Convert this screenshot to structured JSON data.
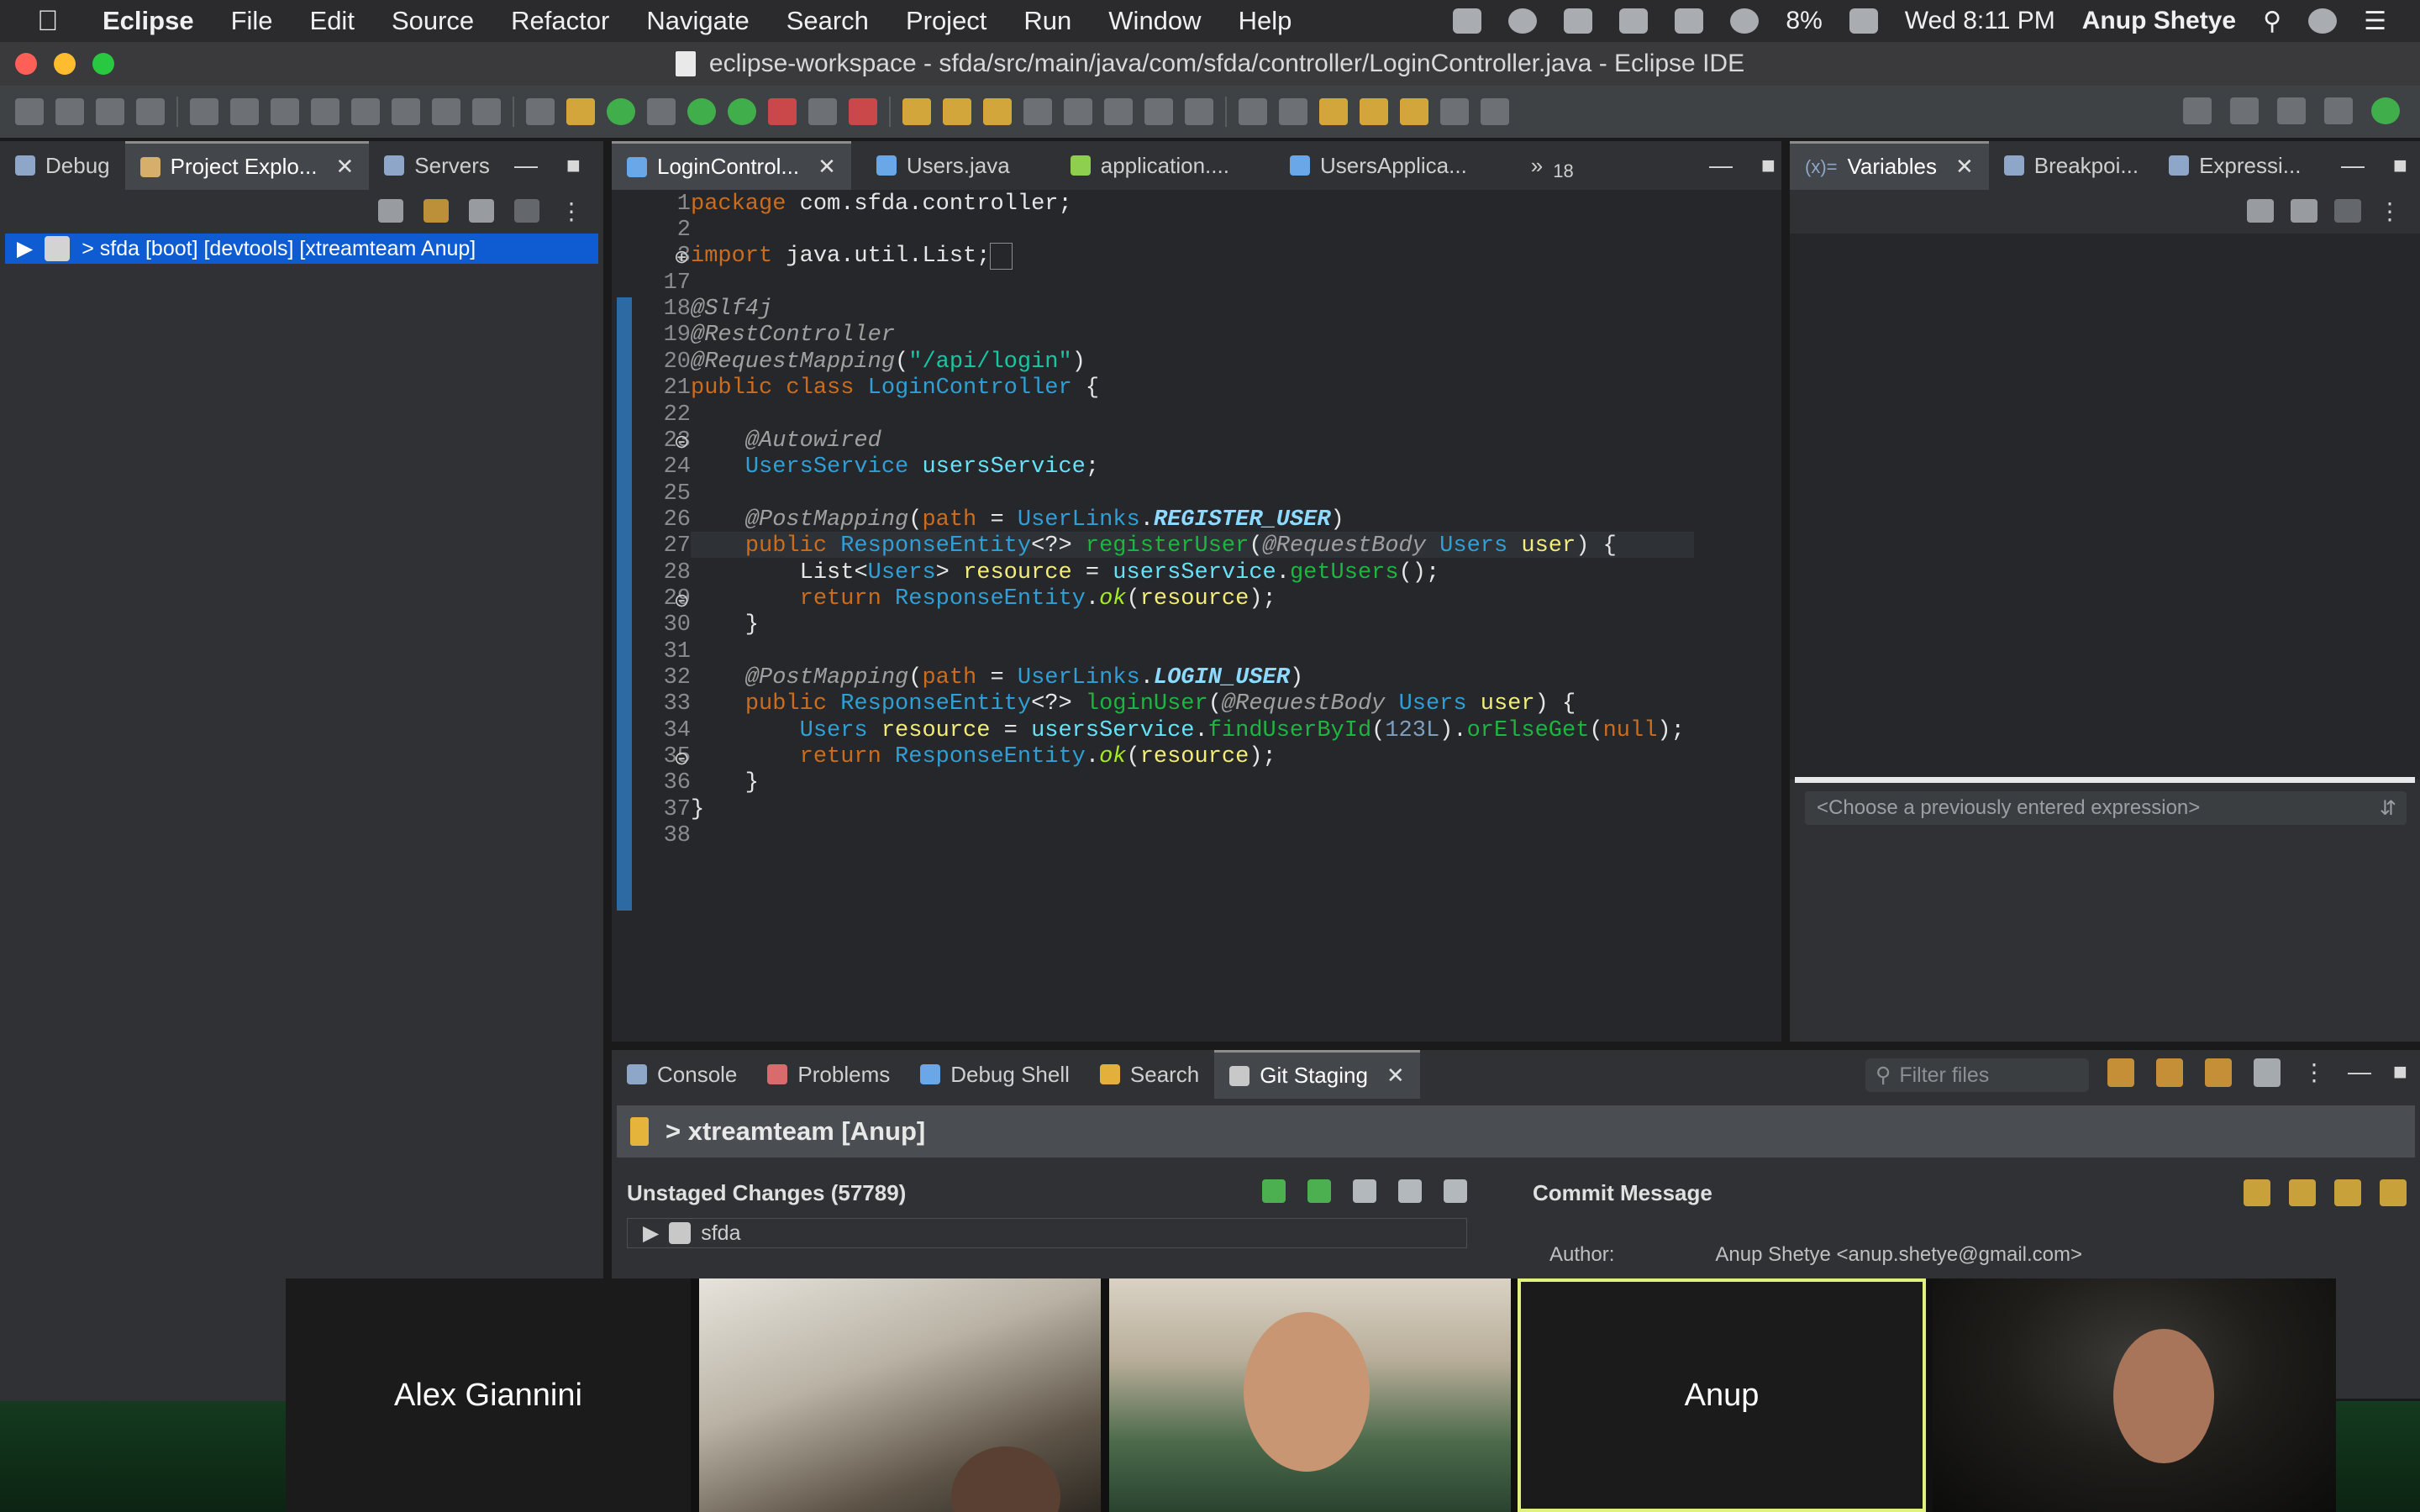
{
  "menubar": {
    "items": [
      "Eclipse",
      "File",
      "Edit",
      "Source",
      "Refactor",
      "Navigate",
      "Search",
      "Project",
      "Run",
      "Window",
      "Help"
    ],
    "battery": "8%",
    "clock": "Wed 8:11 PM",
    "user": "Anup Shetye"
  },
  "window": {
    "title": "eclipse-workspace - sfda/src/main/java/com/sfda/controller/LoginController.java - Eclipse IDE"
  },
  "left_panel": {
    "tabs": [
      "Debug",
      "Project Explo...",
      "Servers"
    ],
    "tree_item": "> sfda [boot] [devtools] [xtreamteam Anup]",
    "status": "sfda"
  },
  "editor": {
    "tabs": [
      "LoginControl...",
      "Users.java",
      "application....",
      "UsersApplica..."
    ],
    "overflow_count": "18",
    "line_numbers": [
      "1",
      "2",
      "3",
      "17",
      "18",
      "19",
      "20",
      "21",
      "22",
      "23",
      "24",
      "25",
      "26",
      "27",
      "28",
      "29",
      "30",
      "31",
      "32",
      "33",
      "34",
      "35",
      "36",
      "37",
      "38"
    ]
  },
  "right_panel": {
    "tabs": [
      "Variables",
      "Breakpoi...",
      "Expressi..."
    ],
    "expression_placeholder": "<Choose a previously entered expression>"
  },
  "bottom_panel": {
    "tabs": [
      "Console",
      "Problems",
      "Debug Shell",
      "Search",
      "Git Staging"
    ],
    "filter_placeholder": "Filter files",
    "repo": "> xtreamteam [Anup]",
    "unstaged_header": "Unstaged Changes (57789)",
    "unstaged_item": "sfda",
    "commit_header": "Commit Message",
    "author_label": "Author:",
    "author_value": "Anup Shetye <anup.shetye@gmail.com>"
  },
  "video_call": {
    "participants": [
      "Alex Giannini",
      "Anup"
    ]
  }
}
